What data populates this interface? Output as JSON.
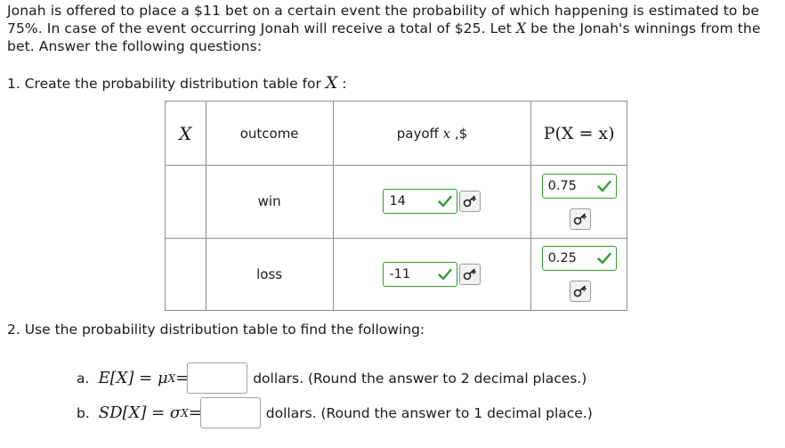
{
  "intro_text": "Jonah is offered to place a $11 bet on a certain event the probability of which happening is estimated to be 75%. In case of the event occurring Jonah will receive a total of $25. Let",
  "intro_var": "X",
  "intro_text_end": "be the Jonah's winnings from the bet. Answer the following questions:",
  "q1": {
    "text": "1. Create the probability distribution table for",
    "var": "X",
    "colon": ":"
  },
  "table": {
    "headers": {
      "x": "X",
      "outcome": "outcome",
      "payoff_prefix": "payoff",
      "payoff_var": "x",
      "payoff_suffix": ",$",
      "prob": "P(X = x)"
    },
    "rows": [
      {
        "x": "",
        "outcome": "win",
        "payoff": "14",
        "prob": "0.75"
      },
      {
        "x": "",
        "outcome": "loss",
        "payoff": "-11",
        "prob": "0.25"
      }
    ]
  },
  "q2": {
    "text": "2. Use the probability distribution table to find the following:"
  },
  "part_a": {
    "label": "a.",
    "expr": "E[X] = μ",
    "sub": "X",
    "eq": "=",
    "value": "",
    "suffix": "dollars. (Round the answer to 2 decimal places.)"
  },
  "part_b": {
    "label": "b.",
    "expr": "SD[X] = σ",
    "sub": "X",
    "eq": "=",
    "value": "",
    "suffix": "dollars. (Round the answer to 1 decimal place.)"
  },
  "colors": {
    "correct_green": "#2e9e2e",
    "border_gray": "#8c8c8c"
  },
  "icons": {
    "correct": "check-icon",
    "key": "key-icon"
  }
}
